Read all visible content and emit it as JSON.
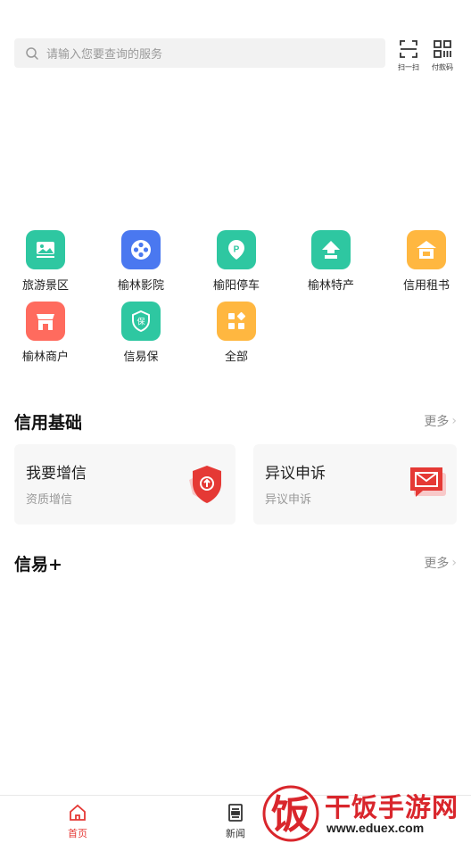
{
  "search": {
    "placeholder": "请输入您要查询的服务",
    "icon": "search-icon"
  },
  "top_actions": [
    {
      "label": "扫一扫",
      "icon": "scan-icon"
    },
    {
      "label": "付款码",
      "icon": "qr-code-icon"
    }
  ],
  "services": [
    {
      "label": "旅游景区",
      "icon": "landscape-icon",
      "color": "#2ec7a1"
    },
    {
      "label": "榆林影院",
      "icon": "film-reel-icon",
      "color": "#4a78f0"
    },
    {
      "label": "榆阳停车",
      "icon": "parking-icon",
      "color": "#2ec7a1"
    },
    {
      "label": "榆林特产",
      "icon": "arrow-up-icon",
      "color": "#2ec7a1"
    },
    {
      "label": "信用租书",
      "icon": "book-house-icon",
      "color": "#ffb740"
    },
    {
      "label": "榆林商户",
      "icon": "shop-icon",
      "color": "#ff6b5e"
    },
    {
      "label": "信易保",
      "icon": "shield-bao-icon",
      "color": "#2ec7a1"
    },
    {
      "label": "全部",
      "icon": "all-apps-icon",
      "color": "#ffb740"
    }
  ],
  "credit_section": {
    "title": "信用基础",
    "more": "更多",
    "cards": [
      {
        "title": "我要增信",
        "subtitle": "资质增信",
        "icon": "shield-upload-icon",
        "color": "#e53935"
      },
      {
        "title": "异议申诉",
        "subtitle": "异议申诉",
        "icon": "message-envelope-icon",
        "color": "#e53935"
      }
    ]
  },
  "xinyi_section": {
    "title": "信易+",
    "more": "更多"
  },
  "bottom_nav": [
    {
      "label": "首页",
      "icon": "home-icon",
      "active": true
    },
    {
      "label": "新闻",
      "icon": "news-icon",
      "active": false
    }
  ],
  "watermark": {
    "text": "干饭手游网",
    "url": "www.eduex.com",
    "logo": "fan-logo"
  },
  "colors": {
    "accent": "#e53935",
    "teal": "#2ec7a1",
    "orange": "#ffb740",
    "blue": "#4a78f0"
  }
}
